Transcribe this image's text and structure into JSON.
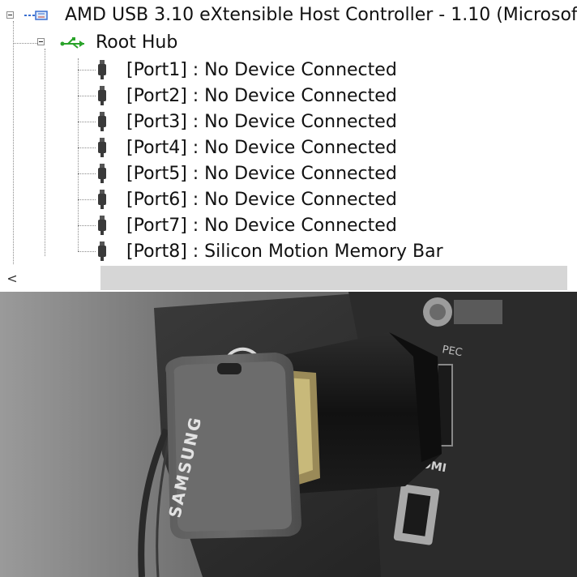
{
  "tree": {
    "controller": {
      "label": "AMD USB 3.10 eXtensible Host Controller - 1.10 (Microsof"
    },
    "hub": {
      "label": "Root Hub"
    },
    "ports": [
      {
        "label": "[Port1] : No Device Connected"
      },
      {
        "label": "[Port2] : No Device Connected"
      },
      {
        "label": "[Port3] : No Device Connected"
      },
      {
        "label": "[Port4] : No Device Connected"
      },
      {
        "label": "[Port5] : No Device Connected"
      },
      {
        "label": "[Port6] : No Device Connected"
      },
      {
        "label": "[Port7] : No Device Connected"
      },
      {
        "label": "[Port8] : Silicon Motion Memory Bar"
      }
    ]
  },
  "scrollbar": {
    "left_arrow": "<"
  },
  "photo": {
    "drive_brand": "SAMSUNG",
    "port_labels": [
      "PEC",
      "HDMI"
    ]
  },
  "icons": {
    "controller": "usb-controller-icon",
    "hub": "usb-hub-icon",
    "port": "usb-port-icon"
  },
  "colors": {
    "hub_icon_green": "#2aa32a",
    "controller_icon_blue": "#3a6fd0",
    "scroll_track": "#d6d6d6"
  }
}
